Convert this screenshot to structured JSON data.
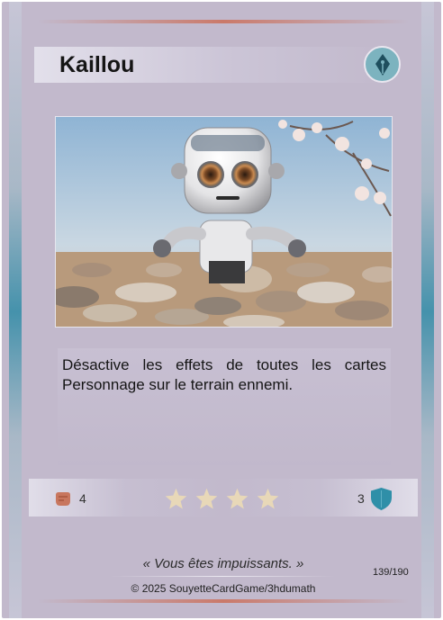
{
  "card": {
    "name": "Kaillou",
    "type_icon": "ink-nib-icon",
    "effect": "Désactive les effets de toutes les cartes Personnage sur le terrain ennemi.",
    "attack": "4",
    "attack_icon": "fist-icon",
    "rating_stars": 4,
    "defense": "3",
    "defense_icon": "shield-icon",
    "quote": "« Vous êtes impuissants. »",
    "collector_number": "139/190",
    "copyright": "© 2025 SouyetteCardGame/3hdumath"
  },
  "colors": {
    "background": "#c2b9cc",
    "badge": "#7cb3bf",
    "attack": "#c8765e",
    "defense": "#2f8fa8",
    "star": "#e8d8b8"
  }
}
